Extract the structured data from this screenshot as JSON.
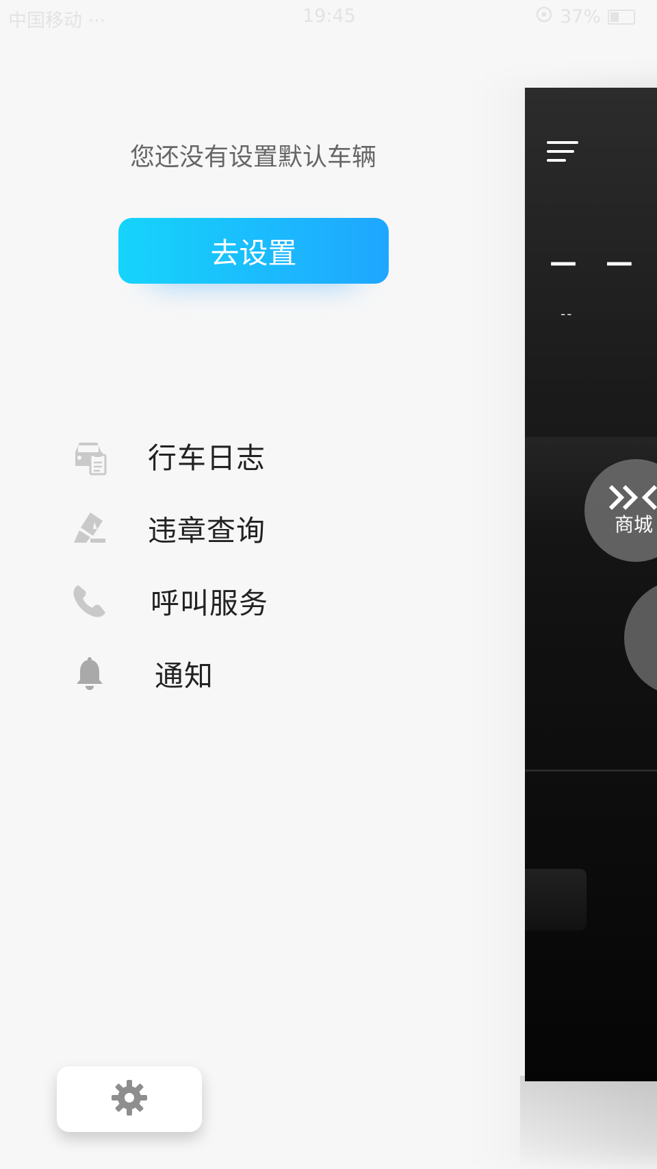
{
  "status_bar": {
    "carrier": "中国移动 ···",
    "time": "19:45",
    "battery_percent": "37%",
    "battery_level": 0.37
  },
  "drawer": {
    "no_vehicle_message": "您还没有设置默认车辆",
    "set_button_label": "去设置",
    "menu_items": [
      {
        "label": "行车日志",
        "icon": "car-log-icon"
      },
      {
        "label": "违章查询",
        "icon": "violation-icon"
      },
      {
        "label": "呼叫服务",
        "icon": "phone-icon"
      },
      {
        "label": "通知",
        "icon": "bell-icon"
      }
    ],
    "settings_icon": "gear-icon"
  },
  "app_panel": {
    "menu_icon": "menu-lines-icon",
    "vehicle_value": "— —",
    "vehicle_sub": "--",
    "mall_label": "商城"
  },
  "colors": {
    "button_gradient_start": "#16d4fb",
    "button_gradient_end": "#1fa6ff",
    "icon_gray": "#c6c6c6",
    "panel_dark": "#111111"
  }
}
